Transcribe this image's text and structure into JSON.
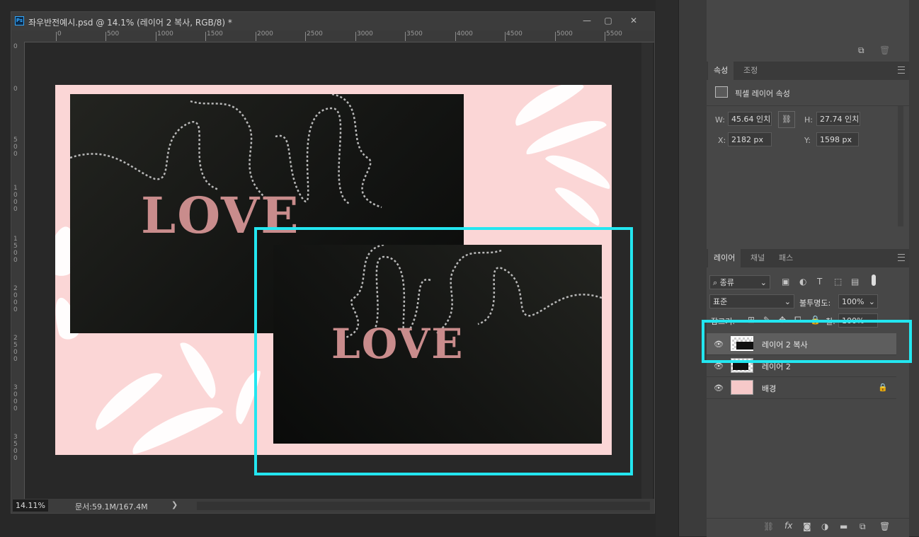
{
  "document": {
    "title": "좌우반전예시.psd @ 14.1% (레이어 2 복사, RGB/8) *",
    "ps_icon": "Ps",
    "window_buttons": {
      "minimize": "—",
      "restore": "▢",
      "close": "✕"
    },
    "ruler_top": [
      "0",
      "500",
      "1000",
      "1500",
      "2000",
      "2500",
      "3000",
      "3500",
      "4000",
      "4500",
      "5000",
      "5500"
    ],
    "ruler_left": [
      "0",
      "0",
      "500",
      "1000",
      "1500",
      "2000",
      "2500",
      "3000",
      "3500"
    ],
    "zoom": "14.11%",
    "doc_size": "문서:59.1M/167.4M",
    "status_arrow": "❯",
    "artwork": {
      "love_text": "LOVE",
      "background_color": "#fbd6d6",
      "highlight_color": "#23e6f0"
    }
  },
  "properties_panel": {
    "tabs": [
      "속성",
      "조정"
    ],
    "header": "픽셀 레이어 속성",
    "w_label": "W:",
    "w_value": "45.64 인치",
    "h_label": "H:",
    "h_value": "27.74 인치",
    "x_label": "X:",
    "x_value": "2182 px",
    "y_label": "Y:",
    "y_value": "1598 px"
  },
  "layers_panel": {
    "tabs": [
      "레이어",
      "채널",
      "패스"
    ],
    "filter_kind": "종류",
    "blend_mode": "표준",
    "opacity_label": "불투명도:",
    "opacity_value": "100%",
    "lock_label": "잠그기:",
    "fill_label": "칠:",
    "fill_value": "100%",
    "layers": [
      {
        "name": "레이어 2 복사",
        "selected": true
      },
      {
        "name": "레이어 2",
        "selected": false
      },
      {
        "name": "배경",
        "selected": false,
        "locked": true
      }
    ],
    "footer_icons": [
      "link-icon",
      "fx-icon",
      "mask-icon",
      "adjustment-icon",
      "folder-icon",
      "new-layer-icon",
      "trash-icon"
    ],
    "fx_label": "fx"
  }
}
